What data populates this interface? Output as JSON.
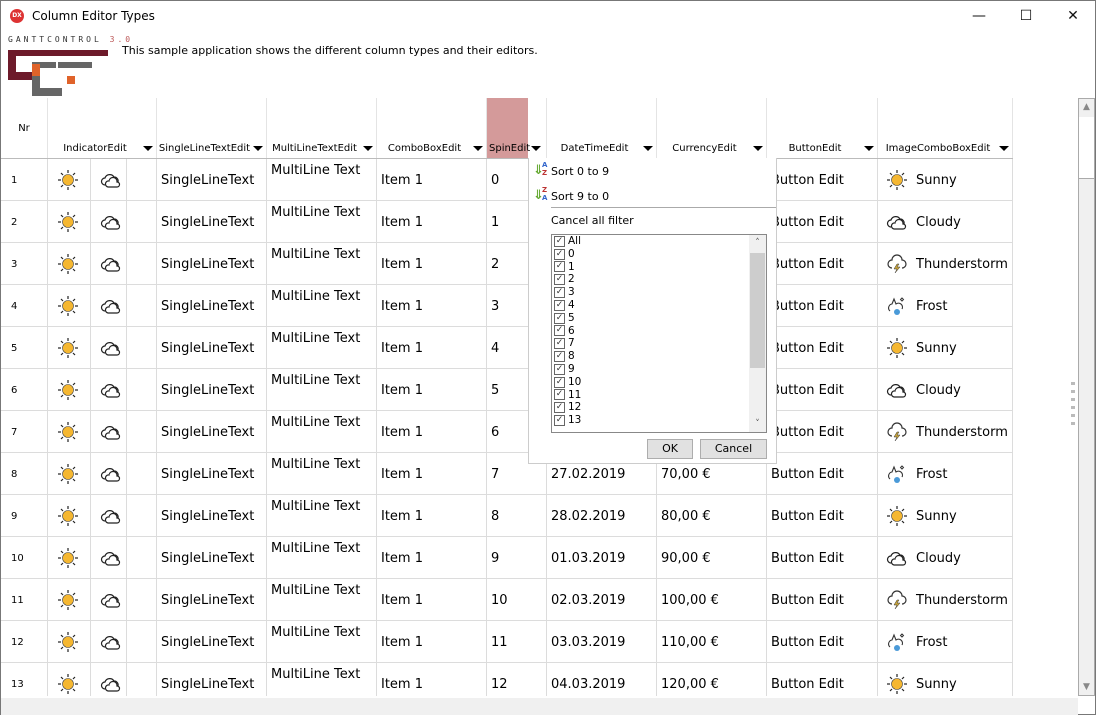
{
  "window": {
    "title": "Column Editor Types",
    "app_icon": "DX",
    "minimize": "—",
    "maximize": "☐",
    "close": "✕"
  },
  "logo": {
    "text": "GANTTCONTROL",
    "version": "3.0"
  },
  "description": "This sample application shows the different column types and their editors.",
  "columns": {
    "nr": "Nr",
    "indicator": "IndicatorEdit",
    "single": "SingleLineTextEdit",
    "multi": "MultiLineTextEdit",
    "combo": "ComboBoxEdit",
    "spin": "SpinEdit",
    "date": "DateTimeEdit",
    "currency": "CurrencyEdit",
    "button": "ButtonEdit",
    "image": "ImageComboBoxEdit"
  },
  "colors": {
    "sorted_header": "#d49a9a",
    "sun": "#f5b731",
    "logo_dark": "#6d1a2a",
    "logo_orange": "#e0632a",
    "logo_gray": "#666666"
  },
  "rows": [
    {
      "nr": "1",
      "single": "SingleLineText",
      "multi": "MultiLine Text",
      "combo": "Item 1",
      "spin": "0",
      "date": "",
      "currency": "",
      "button": "Button Edit",
      "image": "Sunny",
      "image_icon": "sun"
    },
    {
      "nr": "2",
      "single": "SingleLineText",
      "multi": "MultiLine Text",
      "combo": "Item 1",
      "spin": "1",
      "date": "",
      "currency": "",
      "button": "Button Edit",
      "image": "Cloudy",
      "image_icon": "cloud"
    },
    {
      "nr": "3",
      "single": "SingleLineText",
      "multi": "MultiLine Text",
      "combo": "Item 1",
      "spin": "2",
      "date": "",
      "currency": "",
      "button": "Button Edit",
      "image": "Thunderstorm",
      "image_icon": "storm"
    },
    {
      "nr": "4",
      "single": "SingleLineText",
      "multi": "MultiLine Text",
      "combo": "Item 1",
      "spin": "3",
      "date": "",
      "currency": "",
      "button": "Button Edit",
      "image": "Frost",
      "image_icon": "frost"
    },
    {
      "nr": "5",
      "single": "SingleLineText",
      "multi": "MultiLine Text",
      "combo": "Item 1",
      "spin": "4",
      "date": "",
      "currency": "",
      "button": "Button Edit",
      "image": "Sunny",
      "image_icon": "sun"
    },
    {
      "nr": "6",
      "single": "SingleLineText",
      "multi": "MultiLine Text",
      "combo": "Item 1",
      "spin": "5",
      "date": "",
      "currency": "",
      "button": "Button Edit",
      "image": "Cloudy",
      "image_icon": "cloud"
    },
    {
      "nr": "7",
      "single": "SingleLineText",
      "multi": "MultiLine Text",
      "combo": "Item 1",
      "spin": "6",
      "date": "",
      "currency": "",
      "button": "Button Edit",
      "image": "Thunderstorm",
      "image_icon": "storm"
    },
    {
      "nr": "8",
      "single": "SingleLineText",
      "multi": "MultiLine Text",
      "combo": "Item 1",
      "spin": "7",
      "date": "27.02.2019",
      "currency": "70,00 €",
      "button": "Button Edit",
      "image": "Frost",
      "image_icon": "frost"
    },
    {
      "nr": "9",
      "single": "SingleLineText",
      "multi": "MultiLine Text",
      "combo": "Item 1",
      "spin": "8",
      "date": "28.02.2019",
      "currency": "80,00 €",
      "button": "Button Edit",
      "image": "Sunny",
      "image_icon": "sun"
    },
    {
      "nr": "10",
      "single": "SingleLineText",
      "multi": "MultiLine Text",
      "combo": "Item 1",
      "spin": "9",
      "date": "01.03.2019",
      "currency": "90,00 €",
      "button": "Button Edit",
      "image": "Cloudy",
      "image_icon": "cloud"
    },
    {
      "nr": "11",
      "single": "SingleLineText",
      "multi": "MultiLine Text",
      "combo": "Item 1",
      "spin": "10",
      "date": "02.03.2019",
      "currency": "100,00 €",
      "button": "Button Edit",
      "image": "Thunderstorm",
      "image_icon": "storm"
    },
    {
      "nr": "12",
      "single": "SingleLineText",
      "multi": "MultiLine Text",
      "combo": "Item 1",
      "spin": "11",
      "date": "03.03.2019",
      "currency": "110,00 €",
      "button": "Button Edit",
      "image": "Frost",
      "image_icon": "frost"
    },
    {
      "nr": "13",
      "single": "SingleLineText",
      "multi": "MultiLine Text",
      "combo": "Item 1",
      "spin": "12",
      "date": "04.03.2019",
      "currency": "120,00 €",
      "button": "Button Edit",
      "image": "Sunny",
      "image_icon": "sun"
    }
  ],
  "filter_popup": {
    "sort_asc": "Sort 0 to 9",
    "sort_desc": "Sort 9 to 0",
    "sort_asc_icon": "A Z",
    "sort_desc_icon": "Z A",
    "cancel_all": "Cancel all filter",
    "items": [
      "All",
      "0",
      "1",
      "2",
      "3",
      "4",
      "5",
      "6",
      "7",
      "8",
      "9",
      "10",
      "11",
      "12",
      "13"
    ],
    "ok": "OK",
    "cancel": "Cancel"
  }
}
